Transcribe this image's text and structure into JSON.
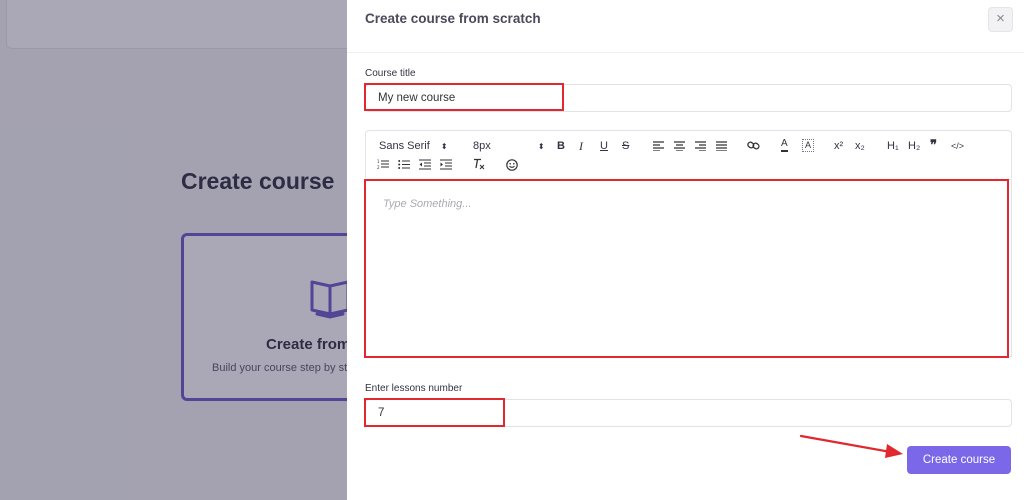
{
  "background": {
    "heading": "Create course",
    "card": {
      "title": "Create from",
      "subtitle": "Build your course step by st"
    }
  },
  "drawer": {
    "title": "Create course from scratch",
    "close_label": "×",
    "course_title_field": {
      "label": "Course title",
      "value": "My new course"
    },
    "editor": {
      "font_select": "Sans Serif",
      "size_select": "8px",
      "buttons": {
        "bold": "B",
        "italic": "I",
        "underline": "U",
        "strike": "S",
        "superscript": "x²",
        "subscript": "x₂",
        "h1": "H₁",
        "h2": "H₂",
        "blockquote": "❞",
        "code": "</>"
      },
      "placeholder": "Type Something..."
    },
    "lessons_field": {
      "label": "Enter lessons number",
      "value": "7"
    },
    "create_button": "Create course"
  },
  "colors": {
    "accent": "#7b68e8",
    "highlight": "#e0282e",
    "card_border": "#6a55c9"
  }
}
